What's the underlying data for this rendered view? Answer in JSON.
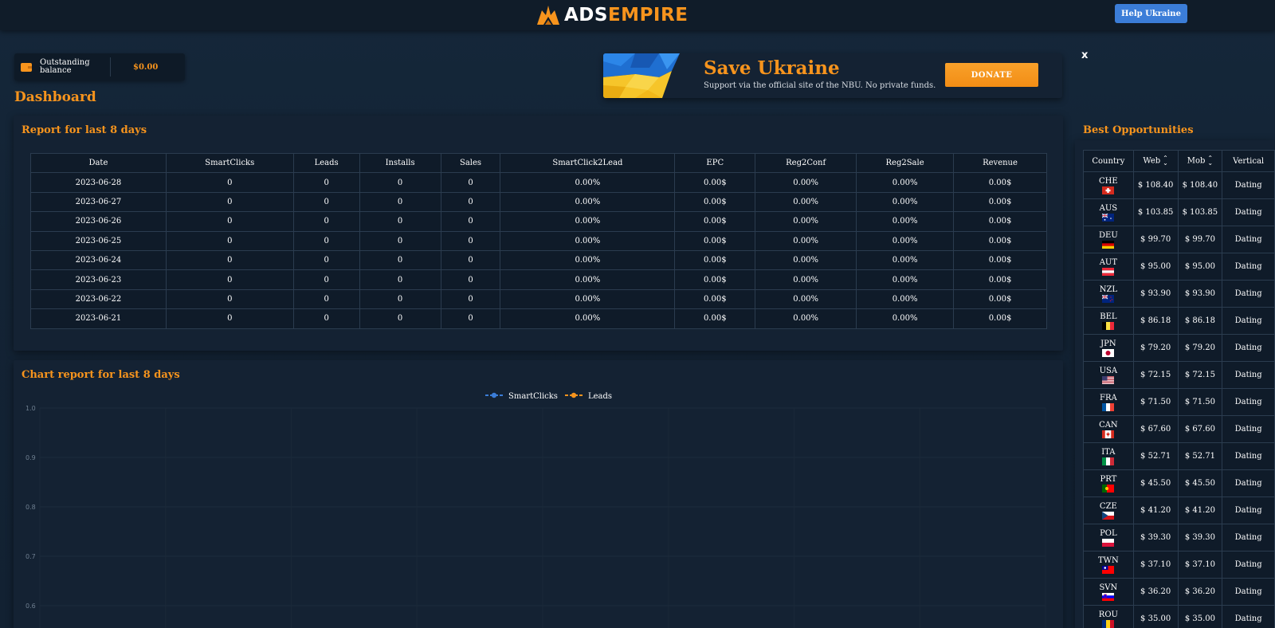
{
  "header": {
    "logo_part1": "ADS",
    "logo_part2": "EMPIRE",
    "help_button": "Help Ukraine"
  },
  "balance": {
    "label": "Outstanding balance",
    "value": "$0.00"
  },
  "page_title": "Dashboard",
  "banner": {
    "title": "Save Ukraine",
    "subtitle": "Support via the official site of the NBU. No private funds.",
    "donate": "DONATE",
    "close": "x"
  },
  "report": {
    "title": "Report for last 8 days",
    "columns": [
      "Date",
      "SmartClicks",
      "Leads",
      "Installs",
      "Sales",
      "SmartClick2Lead",
      "EPC",
      "Reg2Conf",
      "Reg2Sale",
      "Revenue"
    ],
    "rows": [
      [
        "2023-06-28",
        "0",
        "0",
        "0",
        "0",
        "0.00%",
        "0.00$",
        "0.00%",
        "0.00%",
        "0.00$"
      ],
      [
        "2023-06-27",
        "0",
        "0",
        "0",
        "0",
        "0.00%",
        "0.00$",
        "0.00%",
        "0.00%",
        "0.00$"
      ],
      [
        "2023-06-26",
        "0",
        "0",
        "0",
        "0",
        "0.00%",
        "0.00$",
        "0.00%",
        "0.00%",
        "0.00$"
      ],
      [
        "2023-06-25",
        "0",
        "0",
        "0",
        "0",
        "0.00%",
        "0.00$",
        "0.00%",
        "0.00%",
        "0.00$"
      ],
      [
        "2023-06-24",
        "0",
        "0",
        "0",
        "0",
        "0.00%",
        "0.00$",
        "0.00%",
        "0.00%",
        "0.00$"
      ],
      [
        "2023-06-23",
        "0",
        "0",
        "0",
        "0",
        "0.00%",
        "0.00$",
        "0.00%",
        "0.00%",
        "0.00$"
      ],
      [
        "2023-06-22",
        "0",
        "0",
        "0",
        "0",
        "0.00%",
        "0.00$",
        "0.00%",
        "0.00%",
        "0.00$"
      ],
      [
        "2023-06-21",
        "0",
        "0",
        "0",
        "0",
        "0.00%",
        "0.00$",
        "0.00%",
        "0.00%",
        "0.00$"
      ]
    ]
  },
  "chart_data": {
    "type": "line",
    "title": "Chart report for last 8 days",
    "series": [
      {
        "name": "SmartClicks",
        "color": "#3b7dd8",
        "values": []
      },
      {
        "name": "Leads",
        "color": "#f7941d",
        "values": []
      }
    ],
    "y_ticks": [
      "1.0",
      "0.9",
      "0.8",
      "0.7",
      "0.6"
    ],
    "legend_position": "top-center",
    "grid": true
  },
  "best": {
    "title": "Best Opportunities",
    "columns": [
      "Country",
      "Web",
      "Mob",
      "Vertical"
    ],
    "sort_icon": "sort-arrows-icon",
    "rows": [
      {
        "country": "CHE",
        "flag": "flag-che-icon",
        "web": "$ 108.40",
        "mob": "$ 108.40",
        "vertical": "Dating"
      },
      {
        "country": "AUS",
        "flag": "flag-aus-icon",
        "web": "$ 103.85",
        "mob": "$ 103.85",
        "vertical": "Dating"
      },
      {
        "country": "DEU",
        "flag": "flag-deu-icon",
        "web": "$ 99.70",
        "mob": "$ 99.70",
        "vertical": "Dating"
      },
      {
        "country": "AUT",
        "flag": "flag-aut-icon",
        "web": "$ 95.00",
        "mob": "$ 95.00",
        "vertical": "Dating"
      },
      {
        "country": "NZL",
        "flag": "flag-nzl-icon",
        "web": "$ 93.90",
        "mob": "$ 93.90",
        "vertical": "Dating"
      },
      {
        "country": "BEL",
        "flag": "flag-bel-icon",
        "web": "$ 86.18",
        "mob": "$ 86.18",
        "vertical": "Dating"
      },
      {
        "country": "JPN",
        "flag": "flag-jpn-icon",
        "web": "$ 79.20",
        "mob": "$ 79.20",
        "vertical": "Dating"
      },
      {
        "country": "USA",
        "flag": "flag-usa-icon",
        "web": "$ 72.15",
        "mob": "$ 72.15",
        "vertical": "Dating"
      },
      {
        "country": "FRA",
        "flag": "flag-fra-icon",
        "web": "$ 71.50",
        "mob": "$ 71.50",
        "vertical": "Dating"
      },
      {
        "country": "CAN",
        "flag": "flag-can-icon",
        "web": "$ 67.60",
        "mob": "$ 67.60",
        "vertical": "Dating"
      },
      {
        "country": "ITA",
        "flag": "flag-ita-icon",
        "web": "$ 52.71",
        "mob": "$ 52.71",
        "vertical": "Dating"
      },
      {
        "country": "PRT",
        "flag": "flag-prt-icon",
        "web": "$ 45.50",
        "mob": "$ 45.50",
        "vertical": "Dating"
      },
      {
        "country": "CZE",
        "flag": "flag-cze-icon",
        "web": "$ 41.20",
        "mob": "$ 41.20",
        "vertical": "Dating"
      },
      {
        "country": "POL",
        "flag": "flag-pol-icon",
        "web": "$ 39.30",
        "mob": "$ 39.30",
        "vertical": "Dating"
      },
      {
        "country": "TWN",
        "flag": "flag-twn-icon",
        "web": "$ 37.10",
        "mob": "$ 37.10",
        "vertical": "Dating"
      },
      {
        "country": "SVN",
        "flag": "flag-svn-icon",
        "web": "$ 36.20",
        "mob": "$ 36.20",
        "vertical": "Dating"
      },
      {
        "country": "ROU",
        "flag": "flag-rou-icon",
        "web": "$ 35.00",
        "mob": "$ 35.00",
        "vertical": "Dating"
      }
    ]
  },
  "colors": {
    "accent": "#f7941d",
    "primary": "#3b7dd8",
    "panel": "#142233",
    "table_bg": "#0f1b29"
  }
}
